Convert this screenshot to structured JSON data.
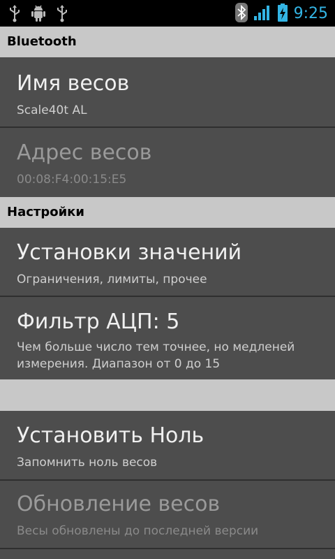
{
  "status_bar": {
    "time": "9:25",
    "left_icons": [
      "usb-icon",
      "android-debug-icon",
      "usb-icon"
    ],
    "right_icons": [
      "bluetooth-icon",
      "signal-icon",
      "battery-charging-icon"
    ],
    "accent": "#33b5e5"
  },
  "sections": {
    "bluetooth": "Bluetooth",
    "settings": "Настройки"
  },
  "prefs": {
    "scale_name": {
      "title": "Имя весов",
      "summary": "Scale40t AL"
    },
    "scale_address": {
      "title": "Адрес весов",
      "summary": "00:08:F4:00:15:E5"
    },
    "value_settings": {
      "title": "Установки значений",
      "summary": "Ограничения, лимиты, прочее"
    },
    "adc_filter": {
      "title": "Фильтр АЦП: 5",
      "summary": "Чем больше число тем точнее, но медленей измерения. Диапазон от 0 до 15"
    },
    "set_zero": {
      "title": "Установить Ноль",
      "summary": "Запомнить ноль весов"
    },
    "update_scale": {
      "title": "Обновление весов",
      "summary": "Весы обновлены до последней версии"
    }
  }
}
